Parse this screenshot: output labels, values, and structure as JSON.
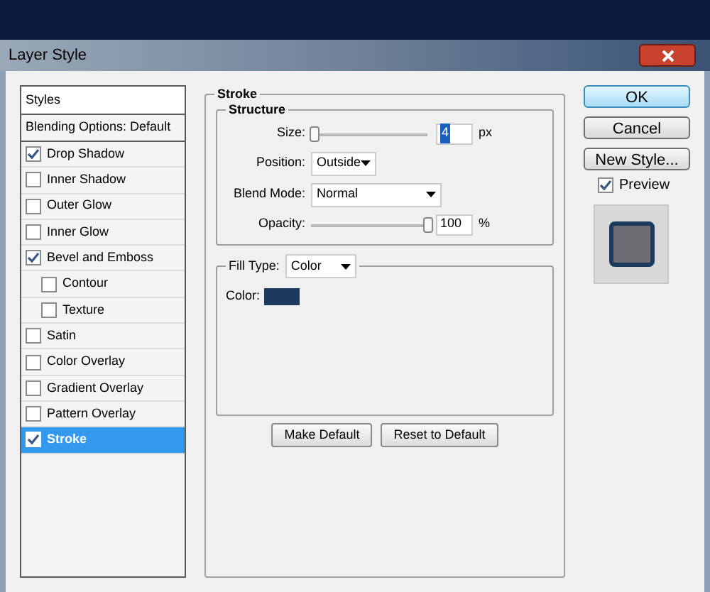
{
  "window": {
    "title": "Layer Style"
  },
  "styles": {
    "header": "Styles",
    "items": [
      {
        "label": "Blending Options: Default",
        "kind": "plain",
        "selected": false
      },
      {
        "label": "Drop Shadow",
        "kind": "check",
        "checked": true,
        "selected": false,
        "indented": false
      },
      {
        "label": "Inner Shadow",
        "kind": "check",
        "checked": false,
        "selected": false,
        "indented": false
      },
      {
        "label": "Outer Glow",
        "kind": "check",
        "checked": false,
        "selected": false,
        "indented": false
      },
      {
        "label": "Inner Glow",
        "kind": "check",
        "checked": false,
        "selected": false,
        "indented": false
      },
      {
        "label": "Bevel and Emboss",
        "kind": "check",
        "checked": true,
        "selected": false,
        "indented": false
      },
      {
        "label": "Contour",
        "kind": "check",
        "checked": false,
        "selected": false,
        "indented": true
      },
      {
        "label": "Texture",
        "kind": "check",
        "checked": false,
        "selected": false,
        "indented": true
      },
      {
        "label": "Satin",
        "kind": "check",
        "checked": false,
        "selected": false,
        "indented": false
      },
      {
        "label": "Color Overlay",
        "kind": "check",
        "checked": false,
        "selected": false,
        "indented": false
      },
      {
        "label": "Gradient Overlay",
        "kind": "check",
        "checked": false,
        "selected": false,
        "indented": false
      },
      {
        "label": "Pattern Overlay",
        "kind": "check",
        "checked": false,
        "selected": false,
        "indented": false
      },
      {
        "label": "Stroke",
        "kind": "check",
        "checked": true,
        "selected": true,
        "indented": false
      }
    ]
  },
  "stroke": {
    "title": "Stroke",
    "structure": {
      "title": "Structure",
      "size": {
        "label": "Size:",
        "level": 0.03,
        "value": "4",
        "unit": "px"
      },
      "position": {
        "label": "Position:",
        "value": "Outside"
      },
      "blend_mode": {
        "label": "Blend Mode:",
        "value": "Normal"
      },
      "opacity": {
        "label": "Opacity:",
        "level": 1,
        "value": "100",
        "unit": "%"
      }
    },
    "fill_type": {
      "label": "Fill Type:",
      "value": "Color",
      "color_label": "Color:",
      "color": "#1c3a5e"
    },
    "buttons": [
      "Make Default",
      "Reset to Default"
    ]
  },
  "side": {
    "buttons": [
      {
        "label": "OK",
        "primary": true
      },
      {
        "label": "Cancel",
        "primary": false
      },
      {
        "label": "New Style...",
        "primary": false
      }
    ],
    "preview": {
      "label": "Preview",
      "checked": true
    }
  }
}
